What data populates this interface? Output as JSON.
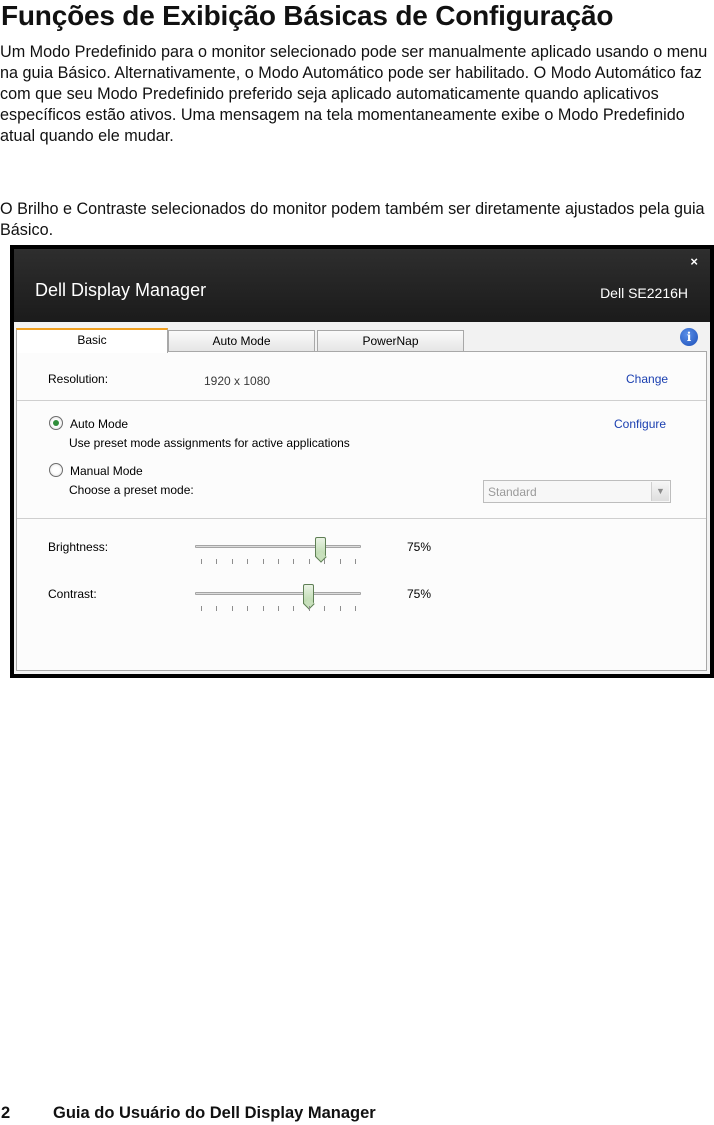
{
  "document": {
    "title": "Funções de Exibição Básicas de Configuração",
    "paragraph1": "Um Modo Predefinido para o monitor selecionado pode ser manualmente aplicado usando o menu na guia Básico. Alternativamente, o Modo Automático pode ser habilitado. O Modo Automático faz com que seu Modo Predefinido preferido seja aplicado automaticamente quando aplicativos específicos estão ativos. Uma mensagem na tela momentaneamente exibe o Modo Predefinido atual quando ele mudar.",
    "paragraph2": "O Brilho e Contraste selecionados do monitor podem também ser diretamente ajustados pela guia Básico.",
    "page_number": "2",
    "footer_title": "Guia do Usuário do Dell Display Manager"
  },
  "app": {
    "title": "Dell Display Manager",
    "monitor_model": "Dell SE2216H",
    "close_glyph": "×",
    "info_glyph": "i",
    "tabs": [
      {
        "label": "Basic",
        "active": true
      },
      {
        "label": "Auto Mode",
        "active": false
      },
      {
        "label": "PowerNap",
        "active": false
      }
    ],
    "resolution": {
      "label": "Resolution:",
      "value": "1920 x 1080",
      "link": "Change"
    },
    "auto_mode": {
      "label": "Auto Mode",
      "description": "Use preset mode assignments for active applications",
      "link": "Configure",
      "selected": true
    },
    "manual_mode": {
      "label": "Manual Mode",
      "description": "Choose a preset mode:",
      "selected": false
    },
    "preset_select": {
      "value": "Standard",
      "enabled": false
    },
    "brightness": {
      "label": "Brightness:",
      "value_text": "75%",
      "level": 75
    },
    "contrast": {
      "label": "Contrast:",
      "value_text": "75%",
      "level": 75
    }
  },
  "colors": {
    "titlebar": "#1b1b1b",
    "link": "#1a3fb0",
    "active_tab_accent": "#f0a020",
    "radio_selected": "#2f8d3a"
  },
  "icons": {
    "close": "close-icon",
    "info": "info-icon",
    "dropdown": "chevron-down-icon",
    "slider_thumb": "slider-thumb"
  }
}
